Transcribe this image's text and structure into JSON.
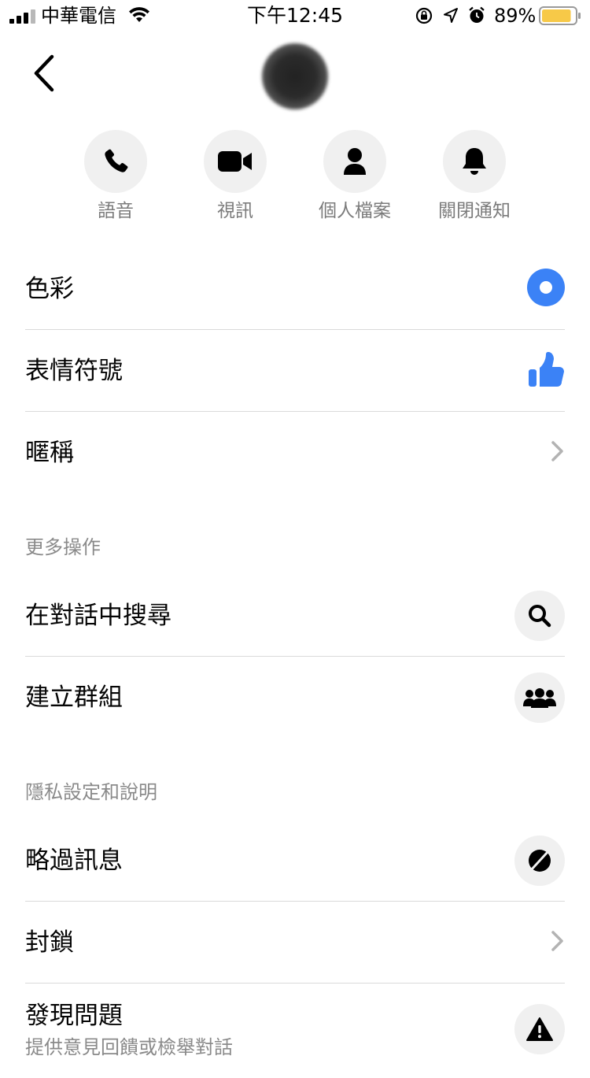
{
  "status_bar": {
    "carrier": "中華電信",
    "time": "下午12:45",
    "battery_percent": "89%",
    "battery_level": 0.89,
    "battery_color": "#f7c948"
  },
  "header": {
    "back_icon": "chevron-left-icon",
    "avatar": "contact-avatar-blurred"
  },
  "actions": [
    {
      "label": "語音",
      "icon": "phone-icon"
    },
    {
      "label": "視訊",
      "icon": "video-camera-icon"
    },
    {
      "label": "個人檔案",
      "icon": "person-icon"
    },
    {
      "label": "關閉通知",
      "icon": "bell-icon"
    }
  ],
  "customize": {
    "color_label": "色彩",
    "emoji_label": "表情符號",
    "nickname_label": "暱稱",
    "accent_color": "#3b82f6"
  },
  "more_actions": {
    "title": "更多操作",
    "search_label": "在對話中搜尋",
    "create_group_label": "建立群組"
  },
  "privacy": {
    "title": "隱私設定和說明",
    "ignore_label": "略過訊息",
    "block_label": "封鎖",
    "report_label": "發現問題",
    "report_sub": "提供意見回饋或檢舉對話"
  }
}
